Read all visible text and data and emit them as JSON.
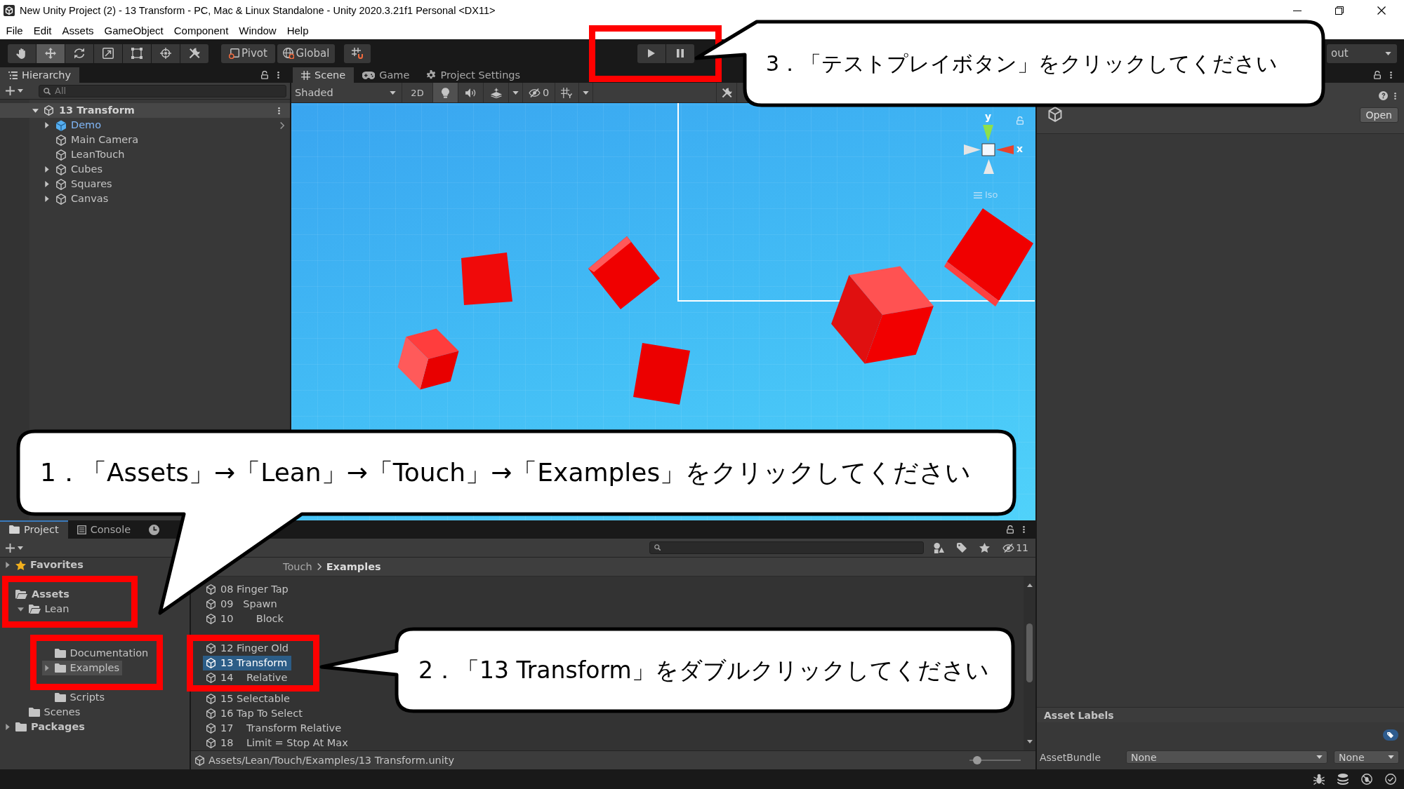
{
  "window": {
    "title": "New Unity Project (2) - 13 Transform - PC, Mac & Linux Standalone - Unity 2020.3.21f1 Personal <DX11>"
  },
  "menu": [
    "File",
    "Edit",
    "Assets",
    "GameObject",
    "Component",
    "Window",
    "Help"
  ],
  "toolbar": {
    "tools": [
      {
        "kind": "hand",
        "selected": false
      },
      {
        "kind": "move",
        "selected": true
      },
      {
        "kind": "rotate",
        "selected": false
      },
      {
        "kind": "scale",
        "selected": false
      },
      {
        "kind": "rect",
        "selected": false
      },
      {
        "kind": "transform",
        "selected": false
      },
      {
        "kind": "custom",
        "selected": false
      }
    ],
    "pivot": "Pivot",
    "space": "Global",
    "playback": [
      {
        "kind": "play"
      },
      {
        "kind": "pause"
      }
    ],
    "layout": "out"
  },
  "hierarchy": {
    "title": "Hierarchy",
    "search": {
      "placeholder": "All"
    },
    "scene": {
      "label": "13 Transform",
      "expanded": true,
      "children": [
        {
          "label": "Demo",
          "kind": "prefab",
          "expandable": true,
          "selected": false
        },
        {
          "label": "Main Camera",
          "kind": "object",
          "expandable": false,
          "selected": false
        },
        {
          "label": "LeanTouch",
          "kind": "object",
          "expandable": false,
          "selected": false
        },
        {
          "label": "Cubes",
          "kind": "object",
          "expandable": true,
          "selected": false
        },
        {
          "label": "Squares",
          "kind": "object",
          "expandable": true,
          "selected": false
        },
        {
          "label": "Canvas",
          "kind": "object",
          "expandable": true,
          "selected": false
        }
      ]
    }
  },
  "scene": {
    "tabs": [
      {
        "label": "Scene",
        "kind": "scene",
        "selected": true
      },
      {
        "label": "Game",
        "kind": "game",
        "selected": false
      },
      {
        "label": "Project Settings",
        "kind": "settings",
        "selected": false
      }
    ],
    "shading": "Shaded",
    "toggles": [
      {
        "kind": "mode",
        "label": "2D",
        "on": false
      },
      {
        "kind": "lighting",
        "on": true
      },
      {
        "kind": "audio",
        "on": false
      },
      {
        "kind": "effects",
        "on": false
      }
    ],
    "hidden_count": "0",
    "gizmo": {
      "y_label": "y",
      "x_label": "x",
      "projection": "Iso"
    }
  },
  "inspector": {
    "open_button": "Open",
    "section": "Asset Labels",
    "asset_bundle": {
      "label": "AssetBundle",
      "value": "None",
      "variant": "None"
    }
  },
  "project": {
    "tabs": [
      {
        "label": "Project",
        "kind": "project",
        "selected": true
      },
      {
        "label": "Console",
        "kind": "console",
        "selected": false
      },
      {
        "kind": "history",
        "selected": false
      }
    ],
    "hidden_count": "11",
    "tree": [
      {
        "label": "Favorites",
        "kind": "favorites",
        "expanded": false,
        "selected": false
      },
      {
        "label": "Assets",
        "kind": "folder",
        "selected": false,
        "children": [
          {
            "label": "Lean",
            "kind": "folder",
            "expanded": true,
            "selected": false,
            "children": [
              {
                "children": [
                  {
                    "label": "Documentation",
                    "kind": "folder",
                    "selected": false
                  },
                  {
                    "label": "Examples",
                    "kind": "folder",
                    "expanded": false,
                    "selected": true
                  },
                  {
                    "label": "Scripts",
                    "kind": "folder",
                    "selected": false
                  }
                ]
              }
            ]
          },
          {
            "label": "Scenes",
            "kind": "folder",
            "selected": false
          }
        ]
      },
      {
        "label": "Packages",
        "kind": "folder",
        "expanded": false,
        "selected": false
      }
    ],
    "breadcrumb": [
      "Touch",
      "Examples"
    ],
    "files": [
      {
        "label": "08 Finger Tap",
        "selected": false
      },
      {
        "label": "09   Spawn",
        "selected": false
      },
      {
        "label": "10       Block",
        "selected": false
      },
      {
        "label": "12 Finger Old",
        "selected": false
      },
      {
        "label": "13 Transform",
        "selected": true
      },
      {
        "label": "14    Relative",
        "selected": false
      },
      {
        "label": "15 Selectable",
        "selected": false
      },
      {
        "label": "16 Tap To Select",
        "selected": false
      },
      {
        "label": "17    Transform Relative",
        "selected": false
      },
      {
        "label": "18    Limit = Stop At Max",
        "selected": false
      }
    ],
    "path": "Assets/Lean/Touch/Examples/13 Transform.unity",
    "zoom_slider": {
      "level": 0.08
    }
  },
  "callouts": [
    {
      "text": "1．「Assets」→「Lean」→「Touch」→「Examples」をクリックしてください"
    },
    {
      "text": "2．「13 Transform」をダブルクリックしてください"
    },
    {
      "text": "3．「テストプレイボタン」をクリックしてください"
    }
  ]
}
